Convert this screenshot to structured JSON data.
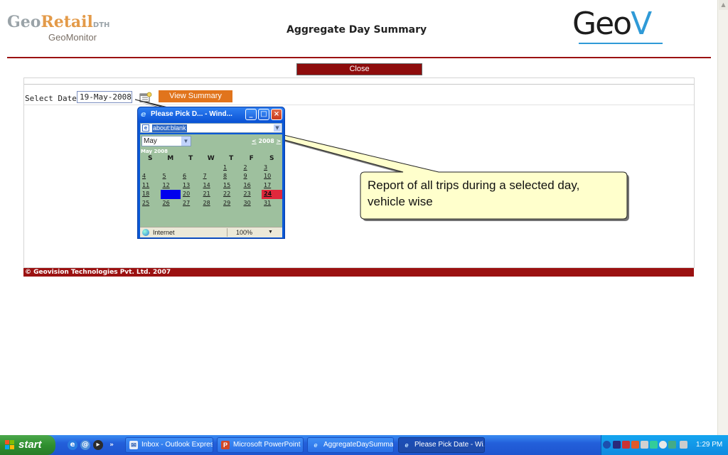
{
  "header": {
    "logo_main_part1": "Geo",
    "logo_main_part2": "Retail",
    "logo_suffix": "DTH",
    "logo_subtitle": "GeoMonitor",
    "page_title": "Aggregate Day Summary",
    "brand_logo_part1": "Geo",
    "brand_logo_part2": "V"
  },
  "close_button_label": "Close",
  "form": {
    "date_label": "Select Date",
    "date_value": "19-May-2008",
    "view_button_label": "View Summary"
  },
  "footer_text": "© Geovision Technologies Pvt. Ltd. 2007",
  "popup": {
    "title": "Please Pick D... - Wind...",
    "address": "about:blank",
    "month_selected": "May",
    "year_nav": "2008",
    "prev_symbol": "<",
    "next_symbol": ">",
    "caption": "May 2008",
    "weekday_headers": [
      "S",
      "M",
      "T",
      "W",
      "T",
      "F",
      "S"
    ],
    "weeks": [
      [
        "",
        "",
        "",
        "",
        "1",
        "2",
        "3"
      ],
      [
        "4",
        "5",
        "6",
        "7",
        "8",
        "9",
        "10"
      ],
      [
        "11",
        "12",
        "13",
        "14",
        "15",
        "16",
        "17"
      ],
      [
        "18",
        "19",
        "20",
        "21",
        "22",
        "23",
        "24"
      ],
      [
        "25",
        "26",
        "27",
        "28",
        "29",
        "30",
        "31"
      ]
    ],
    "selected_day": "19",
    "today_day": "24",
    "status_text": "Internet",
    "zoom": "100%"
  },
  "callout_text": "Report of all trips during a selected day, vehicle wise",
  "taskbar": {
    "start_label": "start",
    "buttons": [
      "Inbox - Outlook Express",
      "Microsoft PowerPoint ...",
      "AggregateDaySumma...",
      "Please Pick Date - Wi..."
    ],
    "clock": "1:29 PM"
  },
  "colors": {
    "brand_red": "#9b1111",
    "button_orange": "#e1741c",
    "calendar_bg": "#9ec09e",
    "selected_blue": "#0000ee",
    "today_red": "#e0283c"
  }
}
